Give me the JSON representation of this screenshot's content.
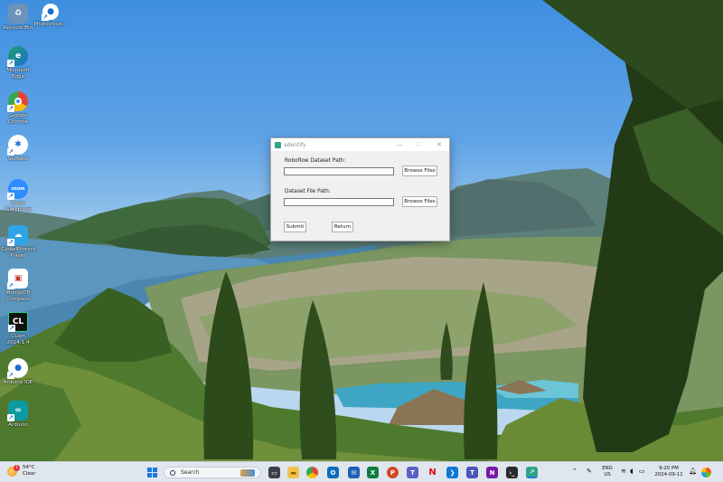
{
  "desktop": {
    "icons": [
      {
        "label": "Recycle Bin",
        "icon": "recycle-bin-icon",
        "color": "#6c93b8"
      },
      {
        "label": "Photoshoot...",
        "icon": "app-shortcut-icon",
        "color": "#1d6ad1"
      },
      {
        "label": "Microsoft Edge",
        "icon": "edge-icon",
        "color": "#1aa06b"
      },
      {
        "label": "Google Chrome",
        "icon": "chrome-icon",
        "color": "#e94235"
      },
      {
        "label": "Selfbest",
        "icon": "selfbest-icon",
        "color": "#1a73c9"
      },
      {
        "label": "Zoom Workplace",
        "icon": "zoom-icon",
        "color": "#2d8cff"
      },
      {
        "label": "GlobalProtect Player",
        "icon": "cloud-icon",
        "color": "#2fa4e7"
      },
      {
        "label": "MongoDB Compass",
        "icon": "box-icon",
        "color": "#c0392b"
      },
      {
        "label": "CLion 2024.1.4",
        "icon": "clion-icon",
        "color": "#111111"
      },
      {
        "label": "Arduino IDE",
        "icon": "arduino-icon",
        "color": "#1d6ad1"
      },
      {
        "label": "Arduino",
        "icon": "infinity-icon",
        "color": "#0d9aa3"
      }
    ]
  },
  "window": {
    "title": "adentify",
    "controls": {
      "minimize": "—",
      "maximize": "☐",
      "close": "✕"
    },
    "roboflow_label": "Roboflow Dataset Path:",
    "roboflow_value": "",
    "dataset_label": "Dataset File Path:",
    "dataset_value": "",
    "browse_label": "Browse Files",
    "submit_label": "Submit",
    "return_label": "Return"
  },
  "taskbar": {
    "weather_temp": "54°C",
    "weather_desc": "Clear",
    "weather_badge": "1",
    "search_label": "Search",
    "apps": [
      "task-view-icon",
      "file-explorer-icon",
      "chrome-icon",
      "outlook-icon",
      "mail-icon",
      "excel-icon",
      "powerpoint-icon",
      "teams-icon",
      "netflix-icon",
      "vscode-icon",
      "teams-alt-icon",
      "onenote-icon",
      "terminal-icon",
      "adentify-app-icon"
    ],
    "lang_top": "ENG",
    "lang_bottom": "US",
    "time": "9:20 PM",
    "date": "2024-09-11"
  }
}
